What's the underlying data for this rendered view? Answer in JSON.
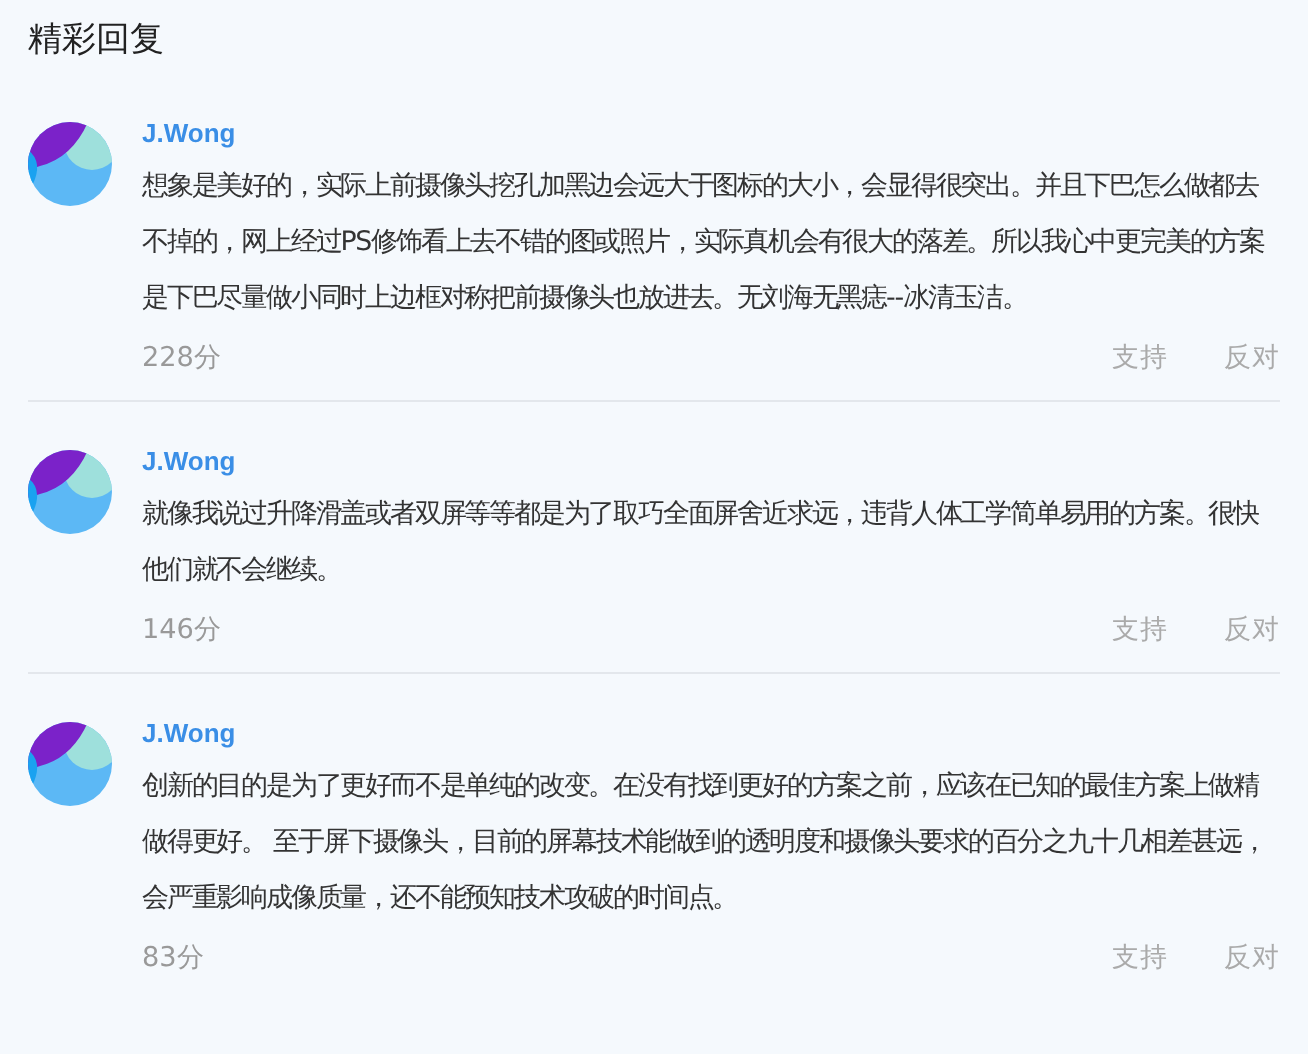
{
  "title": "精彩回复",
  "replies": [
    {
      "author": "J.Wong",
      "text": "想象是美好的，实际上前摄像头挖孔加黑边会远大于图标的大小，会显得很突出。并且下巴怎么做都去不掉的，网上经过PS修饰看上去不错的图或照片，实际真机会有很大的落差。所以我心中更完美的方案是下巴尽量做小同时上边框对称把前摄像头也放进去。无刘海无黑痣--冰清玉洁。",
      "score": "228分",
      "actions": [
        "支持",
        "反对"
      ]
    },
    {
      "author": "J.Wong",
      "text": "就像我说过升降滑盖或者双屏等等都是为了取巧全面屏舍近求远，违背人体工学简单易用的方案。很快他们就不会继续。",
      "score": "146分",
      "actions": [
        "支持",
        "反对"
      ]
    },
    {
      "author": "J.Wong",
      "text": "创新的目的是为了更好而不是单纯的改变。在没有找到更好的方案之前，应该在已知的最佳方案上做精做得更好。 至于屏下摄像头，目前的屏幕技术能做到的透明度和摄像头要求的百分之九十几相差甚远，会严重影响成像质量，还不能预知技术攻破的时间点。",
      "score": "83分",
      "actions": [
        "支持",
        "反对"
      ]
    }
  ]
}
